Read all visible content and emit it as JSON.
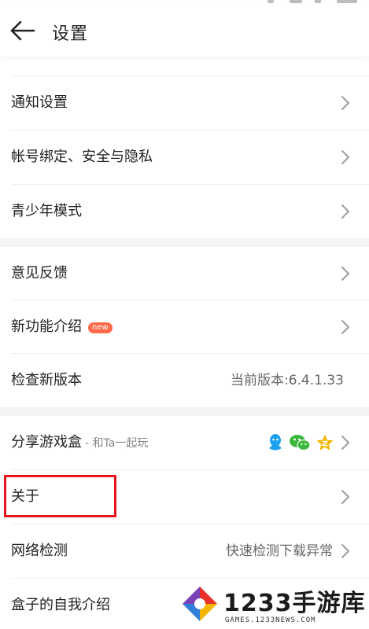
{
  "header": {
    "title": "设置"
  },
  "groups": [
    {
      "items": [
        {
          "label": "通知设置"
        },
        {
          "label": "帐号绑定、安全与隐私"
        },
        {
          "label": "青少年模式"
        }
      ]
    },
    {
      "items": [
        {
          "label": "意见反馈"
        },
        {
          "label": "新功能介绍",
          "badge": "new"
        },
        {
          "label": "检查新版本",
          "value": "当前版本:6.4.1.33"
        }
      ]
    },
    {
      "items": [
        {
          "label": "分享游戏盒",
          "sub": "- 和Ta一起玩",
          "icons": [
            "qq-icon",
            "wechat-icon",
            "qzone-star-icon"
          ]
        },
        {
          "label": "关于"
        },
        {
          "label": "网络检测",
          "value": "快速检测下载异常"
        },
        {
          "label": "盒子的自我介绍"
        }
      ]
    }
  ],
  "watermark": {
    "brand": "1233手游库",
    "url": "GAMES.1233NEWS.COM"
  },
  "colors": {
    "highlight": "#e8141b",
    "badge": "#ff6a4a",
    "qq": "#1ea0f0",
    "wechat": "#3bb83b",
    "star": "#f5b400"
  }
}
